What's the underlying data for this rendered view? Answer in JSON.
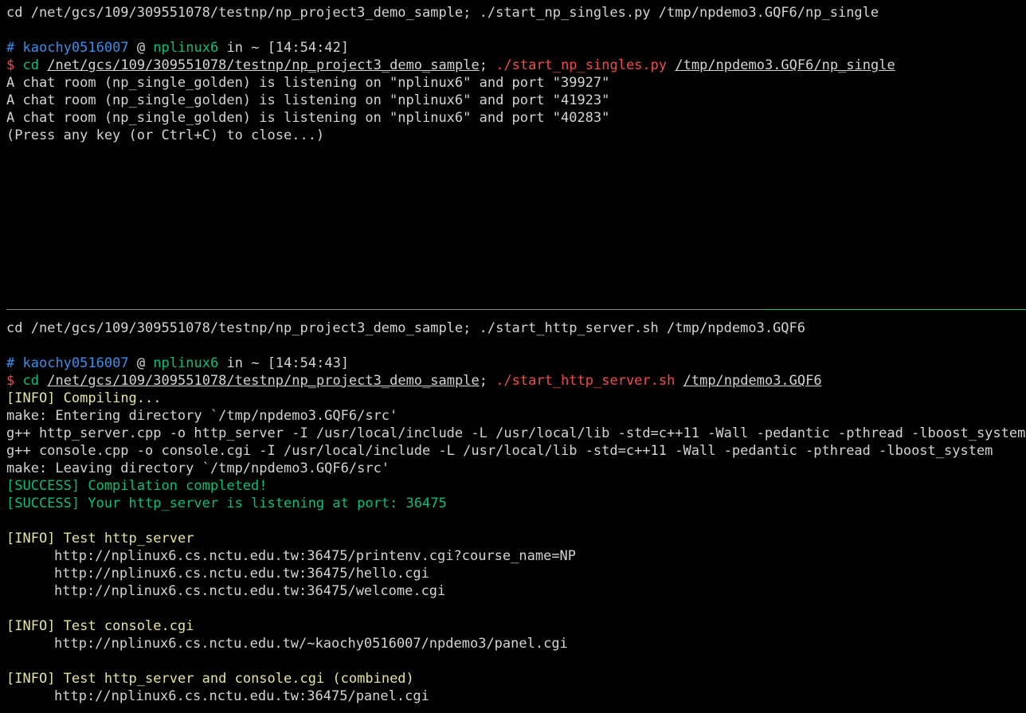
{
  "colors": {
    "background": "#000000",
    "text": "#d4d4d4",
    "user": "#3b8eea",
    "host": "#0dbc79",
    "prompt": "#f14c4c",
    "info": "#e5e5a0",
    "success": "#0dbc79",
    "divider_active": "#0dbc79",
    "divider_inactive": "#8a8a8a"
  },
  "top_pane": {
    "command_header": "cd /net/gcs/109/309551078/testnp/np_project3_demo_sample; ./start_np_singles.py /tmp/npdemo3.GQF6/np_single",
    "prompt": {
      "hash": "#",
      "user": "kaochy0516007",
      "at": "@",
      "host": "nplinux6",
      "in": "in",
      "dir": "~",
      "time": "[14:54:42]"
    },
    "command": {
      "dollar": "$",
      "cd": "cd",
      "path": "/net/gcs/109/309551078/testnp/np_project3_demo_sample",
      "sep": ";",
      "script": "./start_np_singles.py",
      "arg": "/tmp/npdemo3.GQF6/np_single"
    },
    "output": [
      "A chat room (np_single_golden) is listening on \"nplinux6\" and port \"39927\"",
      "A chat room (np_single_golden) is listening on \"nplinux6\" and port \"41923\"",
      "A chat room (np_single_golden) is listening on \"nplinux6\" and port \"40283\"",
      "(Press any key (or Ctrl+C) to close...)"
    ]
  },
  "bottom_pane": {
    "command_header": "cd /net/gcs/109/309551078/testnp/np_project3_demo_sample; ./start_http_server.sh /tmp/npdemo3.GQF6",
    "prompt": {
      "hash": "#",
      "user": "kaochy0516007",
      "at": "@",
      "host": "nplinux6",
      "in": "in",
      "dir": "~",
      "time": "[14:54:43]"
    },
    "command": {
      "dollar": "$",
      "cd": "cd",
      "path": "/net/gcs/109/309551078/testnp/np_project3_demo_sample",
      "sep": ";",
      "script": "./start_http_server.sh",
      "arg": "/tmp/npdemo3.GQF6"
    },
    "compiling": {
      "tag": "[INFO]",
      "text": "Compiling..."
    },
    "make_output": [
      "make: Entering directory `/tmp/npdemo3.GQF6/src'",
      "g++ http_server.cpp -o http_server -I /usr/local/include -L /usr/local/lib -std=c++11 -Wall -pedantic -pthread -lboost_system",
      "g++ console.cpp -o console.cgi -I /usr/local/include -L /usr/local/lib -std=c++11 -Wall -pedantic -pthread -lboost_system",
      "make: Leaving directory `/tmp/npdemo3.GQF6/src'"
    ],
    "success_lines": [
      "[SUCCESS] Compilation completed!",
      "[SUCCESS] Your http_server is listening at port: 36475"
    ],
    "test_http": {
      "tag": "[INFO]",
      "text": "Test http_server",
      "urls": [
        "http://nplinux6.cs.nctu.edu.tw:36475/printenv.cgi?course_name=NP",
        "http://nplinux6.cs.nctu.edu.tw:36475/hello.cgi",
        "http://nplinux6.cs.nctu.edu.tw:36475/welcome.cgi"
      ]
    },
    "test_console": {
      "tag": "[INFO]",
      "text": "Test console.cgi",
      "urls": [
        "http://nplinux6.cs.nctu.edu.tw/~kaochy0516007/npdemo3/panel.cgi"
      ]
    },
    "test_combined": {
      "tag": "[INFO]",
      "text": "Test http_server and console.cgi (combined)",
      "urls": [
        "http://nplinux6.cs.nctu.edu.tw:36475/panel.cgi"
      ]
    }
  }
}
